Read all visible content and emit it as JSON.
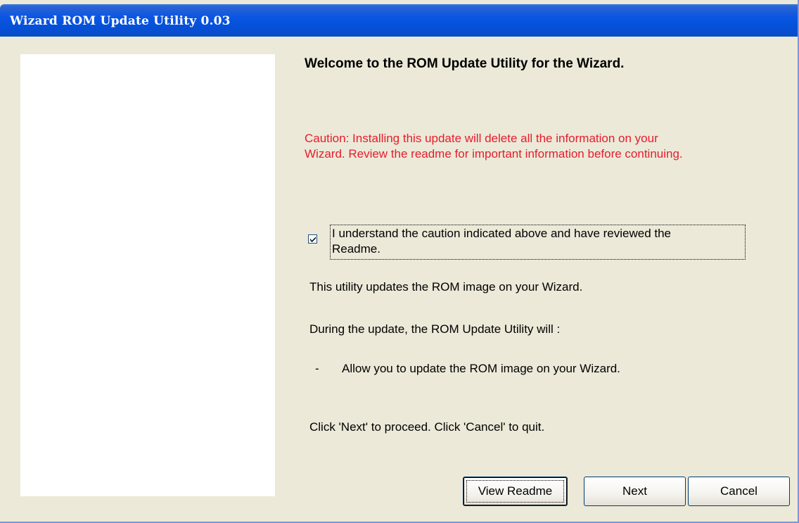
{
  "window": {
    "title": "Wizard ROM Update Utility 0.03"
  },
  "content": {
    "welcome_heading": "Welcome to the ROM Update Utility for the Wizard.",
    "caution_line1": "Caution: Installing this update will delete all the information on your",
    "caution_line2": "Wizard. Review the readme for important information before continuing.",
    "checkbox_label_line1": "I understand the caution indicated above and have reviewed the",
    "checkbox_label_line2": "Readme.",
    "checkbox_checked": true,
    "description": "This utility updates the ROM image on your Wizard.",
    "during_update": "During the update, the ROM Update Utility will :",
    "bullet_dash": "-",
    "bullet_item": "Allow you to update the ROM image on your Wizard.",
    "instructions": "Click 'Next' to proceed. Click 'Cancel' to quit."
  },
  "buttons": {
    "view_readme": "View Readme",
    "next": "Next",
    "cancel": "Cancel"
  },
  "colors": {
    "caution": "#e61c2e",
    "titlebar": "#0a56e3",
    "window_bg": "#ece9d8"
  },
  "icons": {
    "checkbox_mark": "check-icon"
  }
}
